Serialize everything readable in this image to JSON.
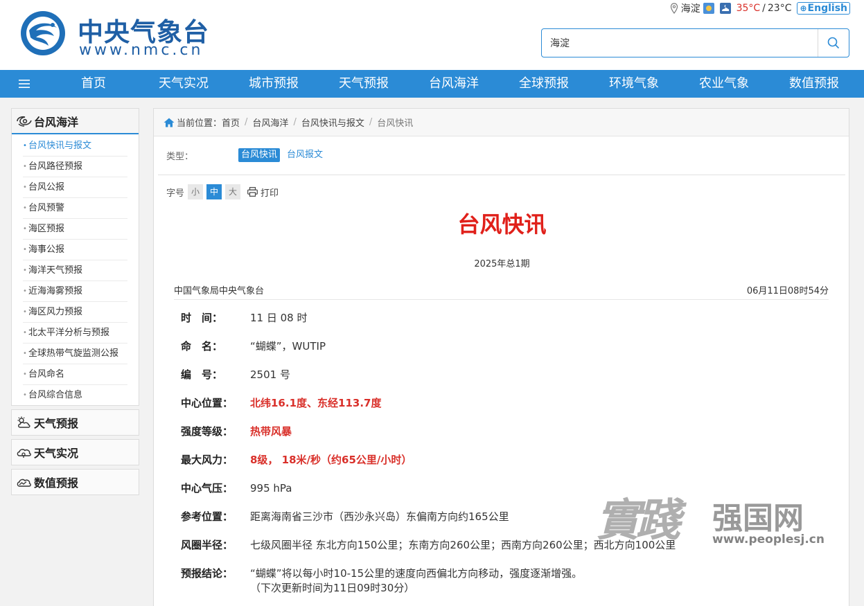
{
  "header": {
    "logo_cn": "中央气象台",
    "logo_url": "www.nmc.cn",
    "location": "海淀",
    "temp_high": "35°C",
    "temp_sep": "/",
    "temp_low": "23°C",
    "english_label": "English",
    "search_value": "海淀"
  },
  "nav": {
    "items": [
      "首页",
      "天气实况",
      "城市预报",
      "天气预报",
      "台风海洋",
      "全球预报",
      "环境气象",
      "农业气象",
      "数值预报"
    ]
  },
  "sidebar": {
    "title": "台风海洋",
    "items": [
      "台风快讯与报文",
      "台风路径预报",
      "台风公报",
      "台风预警",
      "海区预报",
      "海事公报",
      "海洋天气预报",
      "近海海雾预报",
      "海区风力预报",
      "北太平洋分析与预报",
      "全球热带气旋监测公报",
      "台风命名",
      "台风综合信息"
    ],
    "sections": [
      "天气预报",
      "天气实况",
      "数值预报"
    ]
  },
  "breadcrumb": {
    "prefix": "当前位置：",
    "items": [
      "首页",
      "台风海洋",
      "台风快讯与报文",
      "台风快讯"
    ]
  },
  "filter": {
    "label": "类型：",
    "tags": [
      "台风快讯",
      "台风报文"
    ]
  },
  "toolbar": {
    "font_label": "字号",
    "sizes": [
      "小",
      "中",
      "大"
    ],
    "print_label": "打印"
  },
  "article": {
    "title": "台风快讯",
    "issue": "2025年总1期",
    "source": "中国气象局中央气象台",
    "time": "06月11日08时54分",
    "fields": [
      {
        "key": "时　间：",
        "value": "11 日 08 时"
      },
      {
        "key": "命　名：",
        "value": "“蝴蝶”，WUTIP"
      },
      {
        "key": "编　号：",
        "value": "2501 号"
      },
      {
        "key": "中心位置：",
        "value": "北纬16.1度、东经113.7度"
      },
      {
        "key": "强度等级：",
        "value": "热带风暴"
      },
      {
        "key": "最大风力：",
        "value": "8级， 18米/秒（约65公里/小时）"
      },
      {
        "key": "中心气压：",
        "value": "995 hPa"
      },
      {
        "key": "参考位置：",
        "value": "距离海南省三沙市（西沙永兴岛）东偏南方向约165公里"
      },
      {
        "key": "风圈半径：",
        "value": "七级风圈半径 东北方向150公里；东南方向260公里；西南方向260公里；西北方向100公里"
      },
      {
        "key": "预报结论：",
        "value": "“蝴蝶”将以每小时10-15公里的速度向西偏北方向移动，强度逐渐增强。",
        "note": "（下次更新时间为11日09时30分）"
      }
    ]
  },
  "watermark": {
    "script": "實踐",
    "brand": "强国网",
    "url": "www.peoplesj.cn"
  },
  "colors": {
    "accent": "#2b8bd6",
    "title_red": "#e0201a",
    "value_red": "#d9302a",
    "logo_blue": "#1f5fa5"
  }
}
